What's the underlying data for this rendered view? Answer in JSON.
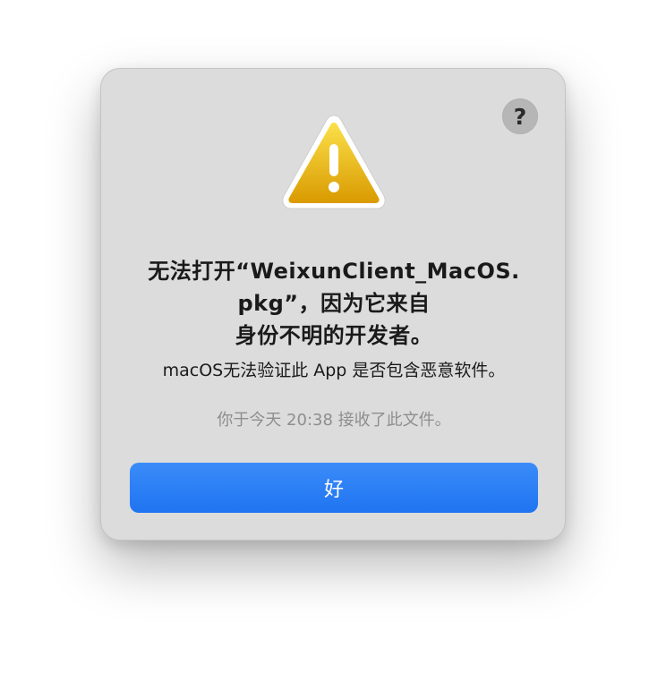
{
  "dialog": {
    "help_label": "?",
    "icon": "warning-triangle-icon",
    "title_lines": [
      "无法打开“WeixunClient_MacOS.",
      "pkg”，因为它来自",
      "身份不明的开发者。"
    ],
    "message": "macOS无法验证此 App 是否包含恶意软件。",
    "received_note": "你于今天 20:38 接收了此文件。",
    "ok_label": "好"
  },
  "colors": {
    "dialog_background": "#dcdcdc",
    "button_blue": "#2b81f6",
    "warning_yellow": "#f2c21a",
    "secondary_text": "#8e8e8e"
  }
}
